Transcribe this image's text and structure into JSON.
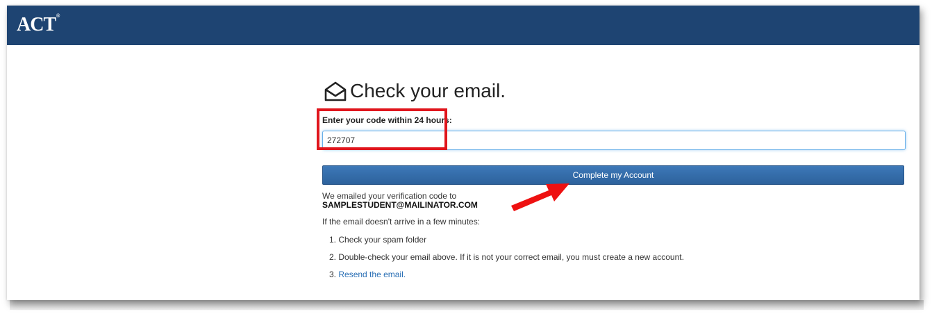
{
  "header": {
    "logo_text": "ACT",
    "logo_mark": "®",
    "background_color": "#1e4472"
  },
  "main": {
    "title_icon": "envelope-open-icon",
    "title": "Check your email.",
    "code_label": "Enter your code within 24 hours:",
    "code_value": "272707",
    "submit_label": "Complete my Account",
    "sent_intro": "We emailed your verification code to",
    "email": "SAMPLESTUDENT@MAILINATOR.COM",
    "help_intro": "If the email doesn't arrive in a few minutes:",
    "steps": [
      {
        "num": "1.",
        "text": "Check your spam folder"
      },
      {
        "num": "2.",
        "text": "Double-check your email above. If it is not your correct email, you must create a new account."
      },
      {
        "num": "3.",
        "text": "Resend the email."
      }
    ]
  },
  "annotations": {
    "highlight_color": "#e0161d",
    "arrow_icon": "red-arrow-icon"
  }
}
